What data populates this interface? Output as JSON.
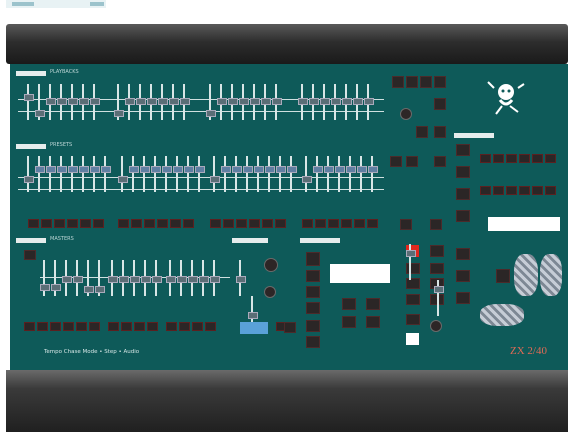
{
  "section_labels": {
    "playbacks": "PLAYBACKS",
    "presets": "PRESETS",
    "masters": "MASTERS"
  },
  "footer": {
    "text": "Tempo Chase Mode  •  Step  •  Audio"
  },
  "brand": {
    "text": "ZX 2/40"
  },
  "colors": {
    "panel": "#0e5a59",
    "rail": "#2d2d2d",
    "accent_red": "#e0281e",
    "accent_blue": "#5aa1d8"
  },
  "icons": [
    "logo-dancer-icon",
    "jog-wheel-icon",
    "trackball-icon"
  ]
}
